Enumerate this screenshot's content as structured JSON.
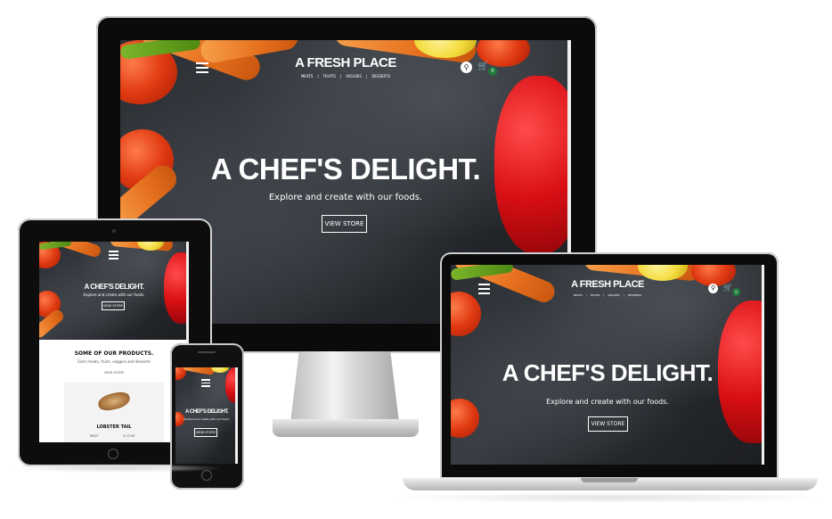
{
  "site": {
    "logo": "A FRESH PLACE",
    "nav": [
      "MEATS",
      "FRUITS",
      "VEGGIES",
      "DESSERTS"
    ],
    "nav_sep": "|",
    "hero_title": "A CHEF'S DELIGHT.",
    "hero_subtitle": "Explore and create with our foods.",
    "cta_label": "VIEW STORE",
    "cart_count": "0"
  },
  "products": {
    "heading": "SOME OF OUR PRODUCTS.",
    "subheading": "Farm meats, fruits, veggies and desserts",
    "link": "VIEW STORE",
    "item_name": "LOBSTER TAIL",
    "item_category": "MEAT",
    "item_price": "$ 23.99"
  },
  "icons": {
    "menu": "hamburger-menu-icon",
    "search": "search-icon",
    "cart": "shopping-cart-icon"
  },
  "colors": {
    "badge": "#1f7a3a",
    "hero_bg": "#2b2e33"
  }
}
